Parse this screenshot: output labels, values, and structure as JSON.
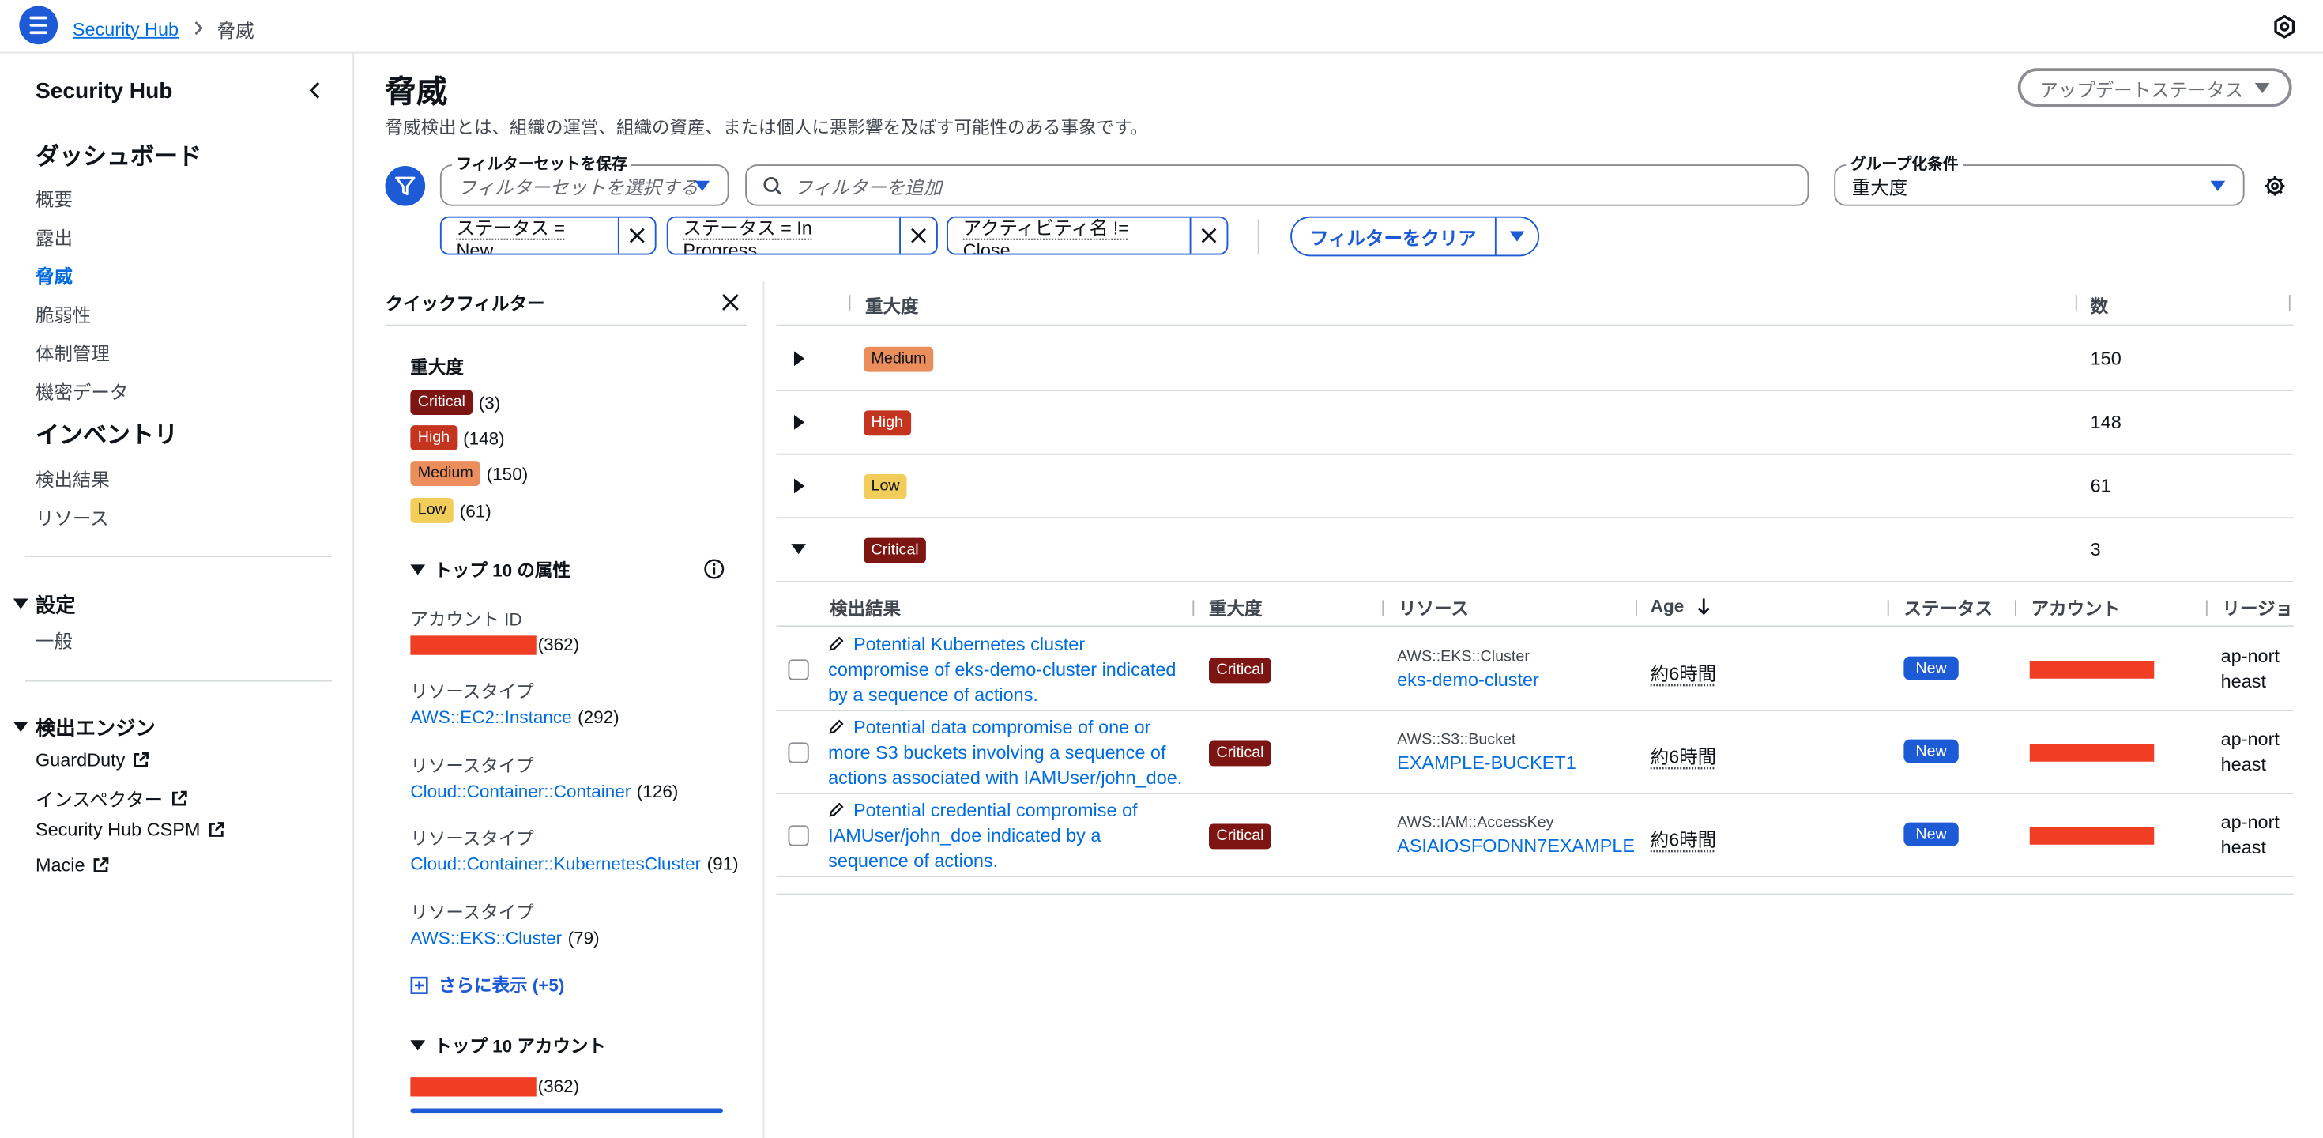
{
  "topbar": {
    "breadcrumb_root": "Security Hub",
    "breadcrumb_sep": ">",
    "breadcrumb_current": "脅威"
  },
  "sidebar": {
    "title": "Security Hub",
    "dashboard_heading": "ダッシュボード",
    "dashboard_items": [
      "概要",
      "露出",
      "脅威",
      "脆弱性",
      "体制管理",
      "機密データ"
    ],
    "active_item": "脅威",
    "inventory_heading": "インベントリ",
    "inventory_items": [
      "検出結果",
      "リソース"
    ],
    "settings_section": "設定",
    "settings_items": [
      "一般"
    ],
    "engines_section": "検出エンジン",
    "engine_items": [
      "GuardDuty",
      "インスペクター",
      "Security Hub CSPM",
      "Macie"
    ]
  },
  "header": {
    "title": "脅威",
    "description": "脅威検出とは、組織の運営、組織の資産、または個人に悪影響を及ぼす可能性のある事象です。",
    "update_status_button": "アップデートステータス"
  },
  "filters": {
    "filterset_label": "フィルターセットを保存",
    "filterset_placeholder": "フィルターセットを選択する",
    "search_placeholder": "フィルターを追加",
    "group_label": "グループ化条件",
    "group_value": "重大度",
    "tokens": [
      "ステータス = New",
      "ステータス = In Progress",
      "アクティビティ名 != Close"
    ],
    "clear_button": "フィルターをクリア"
  },
  "quick_filters": {
    "title": "クイックフィルター",
    "severity_heading": "重大度",
    "severities": [
      {
        "label": "Critical",
        "count": "(3)"
      },
      {
        "label": "High",
        "count": "(148)"
      },
      {
        "label": "Medium",
        "count": "(150)"
      },
      {
        "label": "Low",
        "count": "(61)"
      }
    ],
    "top_attributes_heading": "トップ 10 の属性",
    "attributes": [
      {
        "label": "アカウント ID",
        "value": "",
        "count": "(362)"
      },
      {
        "label": "リソースタイプ",
        "value": "AWS::EC2::Instance",
        "count": "(292)"
      },
      {
        "label": "リソースタイプ",
        "value": "Cloud::Container::Container",
        "count": "(126)"
      },
      {
        "label": "リソースタイプ",
        "value": "Cloud::Container::KubernetesCluster",
        "count": "(91)"
      },
      {
        "label": "リソースタイプ",
        "value": "AWS::EKS::Cluster",
        "count": "(79)"
      }
    ],
    "show_more": "さらに表示 (+5)",
    "top_accounts_heading": "トップ 10 アカウント",
    "top_account_count": "(362)"
  },
  "table": {
    "columns": [
      "重大度",
      "数"
    ],
    "groups": [
      {
        "severity": "Medium",
        "count": "150"
      },
      {
        "severity": "High",
        "count": "148"
      },
      {
        "severity": "Low",
        "count": "61"
      },
      {
        "severity": "Critical",
        "count": "3"
      }
    ],
    "sub_columns": [
      "検出結果",
      "重大度",
      "リソース",
      "Age",
      "ステータス",
      "アカウント",
      "リージョ"
    ],
    "findings": [
      {
        "title": "Potential Kubernetes cluster compromise of eks-demo-cluster indicated by a sequence of actions.",
        "severity": "Critical",
        "resource_type": "AWS::EKS::Cluster",
        "resource_name": "eks-demo-cluster",
        "age": "約6時間",
        "status": "New",
        "region": "ap-northeast"
      },
      {
        "title": "Potential data compromise of one or more S3 buckets involving a sequence of actions associated with IAMUser/john_doe.",
        "severity": "Critical",
        "resource_type": "AWS::S3::Bucket",
        "resource_name": "EXAMPLE-BUCKET1",
        "age": "約6時間",
        "status": "New",
        "region": "ap-northeast"
      },
      {
        "title": "Potential credential compromise of IAMUser/john_doe indicated by a sequence of actions.",
        "severity": "Critical",
        "resource_type": "AWS::IAM::AccessKey",
        "resource_name": "ASIAIOSFODNN7EXAMPLE",
        "age": "約6時間",
        "status": "New",
        "region": "ap-northeast"
      }
    ]
  },
  "colors": {
    "accent": "#1c5ad6",
    "link": "#006ce0",
    "critical": "#7d1512",
    "high": "#c4341f",
    "medium": "#ec8d5c",
    "low": "#f2cd59",
    "redaction": "#f03e25"
  },
  "icons": [
    "menu-icon",
    "chevron-right-icon",
    "settings-icon",
    "chevron-left-icon",
    "external-link-icon",
    "filter-icon",
    "search-icon",
    "caret-down-icon",
    "close-icon",
    "info-icon",
    "expand-icon",
    "sort-down-icon",
    "edit-icon"
  ]
}
